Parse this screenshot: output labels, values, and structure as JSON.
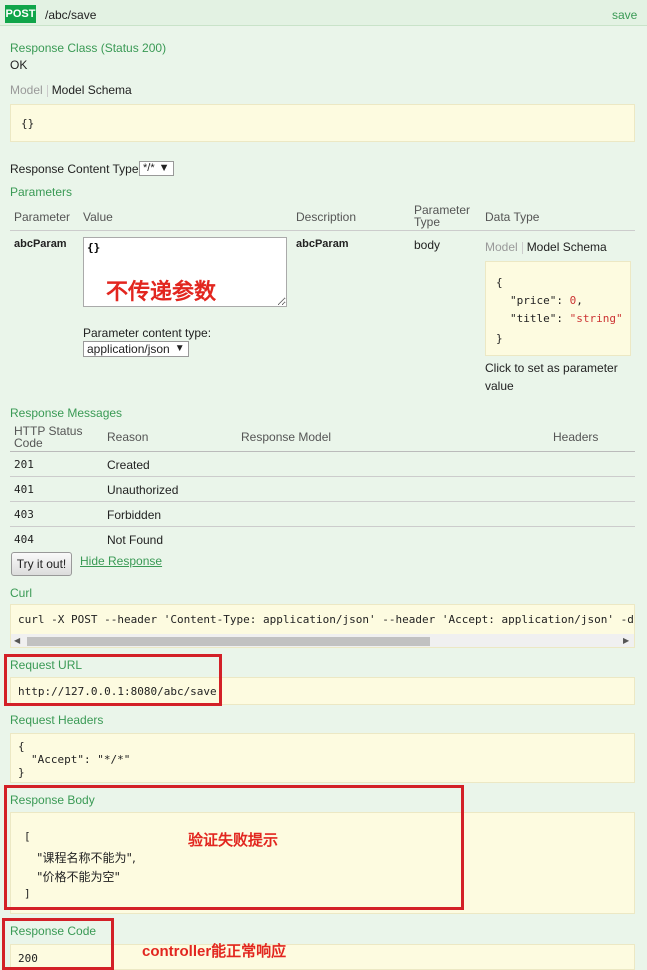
{
  "endpoint": {
    "method": "POST",
    "path": "/abc/save",
    "action_link": "save"
  },
  "response_class": {
    "title": "Response Class (Status 200)",
    "status_text": "OK",
    "tab_model": "Model",
    "tab_schema": "Model Schema",
    "schema": "{}"
  },
  "content_type": {
    "label": "Response Content Type",
    "value": "*/*"
  },
  "parameters": {
    "title": "Parameters",
    "headers": {
      "parameter": "Parameter",
      "value": "Value",
      "description": "Description",
      "param_type": "Parameter Type",
      "data_type": "Data Type"
    },
    "row": {
      "name": "abcParam",
      "value": "{}",
      "description": "abcParam",
      "type": "body",
      "content_type_label": "Parameter content type:",
      "content_type_value": "application/json",
      "tab_model": "Model",
      "tab_schema": "Model Schema",
      "schema_lines": [
        "{",
        "\"price\": 0,",
        "\"title\": \"string\"",
        "}"
      ],
      "schema_key_price": "\"price\"",
      "schema_val_price": "0",
      "schema_key_title": "\"title\"",
      "schema_val_title": "\"string\"",
      "click_hint": "Click to set as parameter value"
    },
    "annotation": "不传递参数"
  },
  "response_messages": {
    "title": "Response Messages",
    "headers": {
      "code": "HTTP Status Code",
      "reason": "Reason",
      "model": "Response Model",
      "headers": "Headers"
    },
    "rows": [
      {
        "code": "201",
        "reason": "Created"
      },
      {
        "code": "401",
        "reason": "Unauthorized"
      },
      {
        "code": "403",
        "reason": "Forbidden"
      },
      {
        "code": "404",
        "reason": "Not Found"
      }
    ]
  },
  "actions": {
    "try_button": "Try it out!",
    "hide_link": "Hide Response"
  },
  "curl": {
    "title": "Curl",
    "command": "curl -X POST --header 'Content-Type: application/json' --header 'Accept: application/json' -d"
  },
  "request_url": {
    "title": "Request URL",
    "value": "http://127.0.0.1:8080/abc/save"
  },
  "request_headers": {
    "title": "Request Headers",
    "line1": "{",
    "line2": "\"Accept\": \"*/*\"",
    "line3": "}"
  },
  "response_body": {
    "title": "Response Body",
    "line1": "[",
    "line2": "\"课程名称不能为\",",
    "line3": "\"价格不能为空\"",
    "line4": "]",
    "annotation": "验证失败提示"
  },
  "response_code": {
    "title": "Response Code",
    "value": "200",
    "annotation": "controller能正常响应"
  },
  "colors": {
    "accent": "#3a9a55",
    "method_badge": "#10a54a",
    "highlight_red": "#d32027"
  }
}
